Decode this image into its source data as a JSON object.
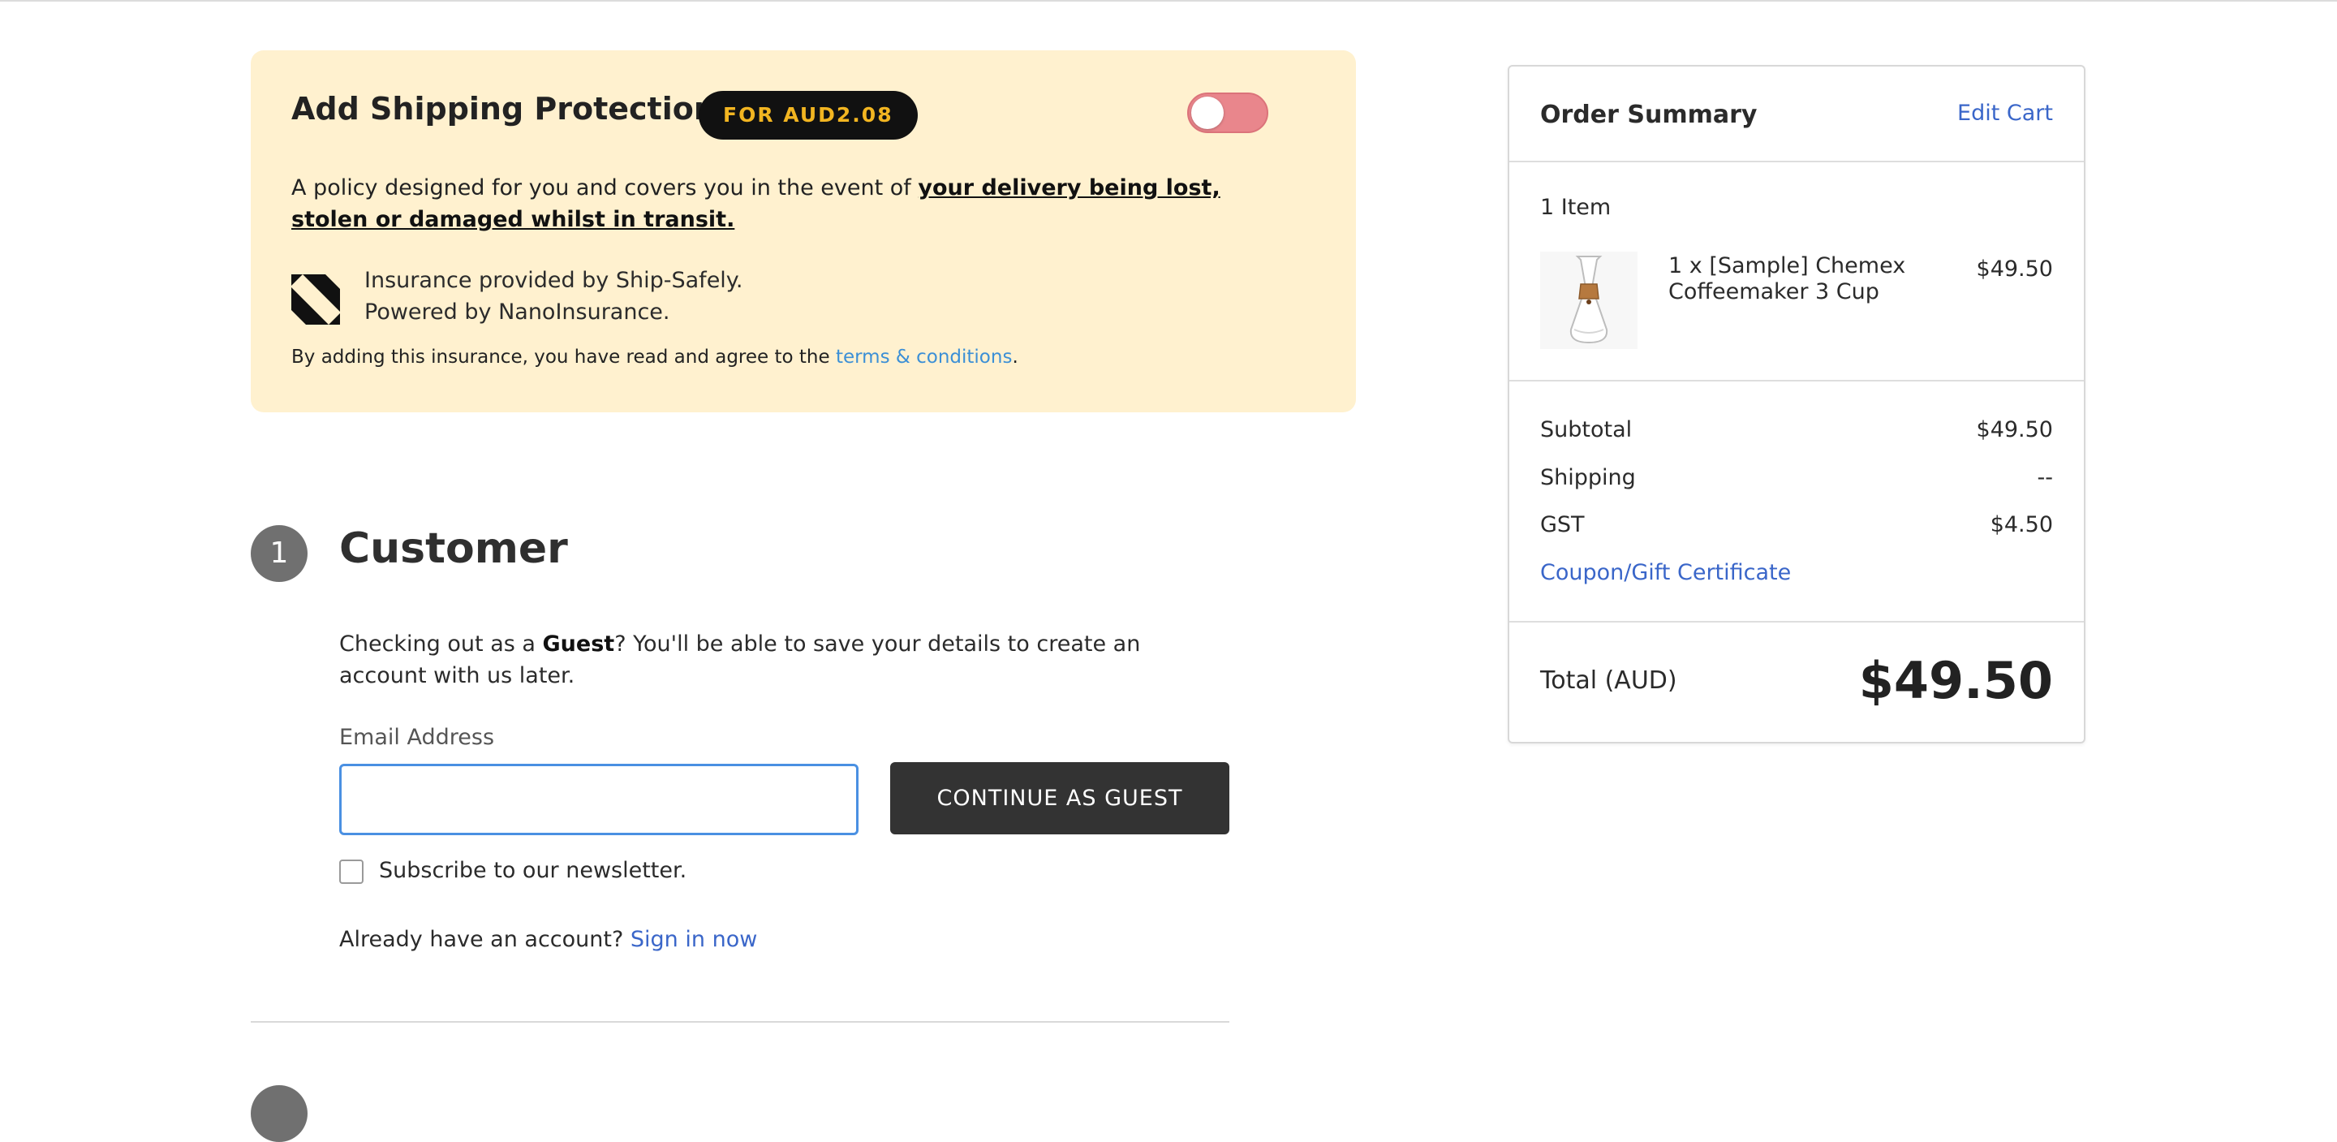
{
  "protection": {
    "title": "Add Shipping Protection",
    "price_badge": "FOR AUD2.08",
    "toggle_enabled": false,
    "policy_prefix": "A policy designed for you and covers you in the event of ",
    "policy_emphasis": "your delivery being lost, stolen or damaged whilst in transit.",
    "insurer_line1": "Insurance provided by Ship-Safely.",
    "insurer_line2": "Powered by NanoInsurance.",
    "agree_prefix": "By adding this insurance, you have read and agree to the ",
    "terms_link": "terms & conditions",
    "agree_suffix": ".",
    "logo_icon": "ship-safely-logo-icon",
    "colors": {
      "card_bg": "#fff1cf",
      "badge_bg": "#111111",
      "badge_text": "#f2b521",
      "toggle_bg": "#e9868c"
    }
  },
  "customer": {
    "step_number": "1",
    "title": "Customer",
    "guest_prefix": "Checking out as a ",
    "guest_bold": "Guest",
    "guest_suffix": "? You'll be able to save your details to create an account with us later.",
    "email_label": "Email Address",
    "email_value": "",
    "email_placeholder": "",
    "continue_label": "CONTINUE AS GUEST",
    "newsletter_label": "Subscribe to our newsletter.",
    "newsletter_checked": false,
    "signin_prefix": "Already have an account?",
    "signin_link": "Sign in now"
  },
  "summary": {
    "title": "Order Summary",
    "edit_cart": "Edit Cart",
    "item_count": "1 Item",
    "items": [
      {
        "name": "1 x [Sample] Chemex Coffeemaker 3 Cup",
        "price": "$49.50",
        "image_icon": "chemex-coffeemaker-image"
      }
    ],
    "rows": [
      {
        "label": "Subtotal",
        "value": "$49.50"
      },
      {
        "label": "Shipping",
        "value": "--"
      },
      {
        "label": "GST",
        "value": "$4.50"
      }
    ],
    "coupon_link": "Coupon/Gift Certificate",
    "total_label": "Total (AUD)",
    "total_value": "$49.50",
    "colors": {
      "link": "#3a66c9"
    }
  }
}
